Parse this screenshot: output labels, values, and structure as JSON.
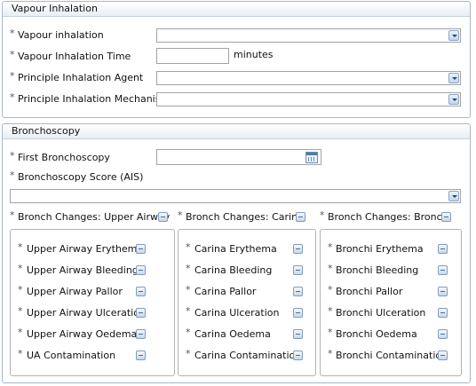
{
  "vapour": {
    "title": "Vapour Inhalation",
    "vapour_inhalation": "Vapour inhalation",
    "inhalation_time": "Vapour Inhalation Time",
    "minutes": "minutes",
    "agent": "Principle Inhalation Agent",
    "mechanism": "Principle Inhalation Mechanism"
  },
  "bronch": {
    "title": "Bronchoscopy",
    "first": "First Bronchoscopy",
    "score": "Bronchoscopy Score (AIS)",
    "col1": {
      "header": "Bronch Changes: Upper Airway",
      "items": [
        "Upper Airway Erythema",
        "Upper Airway Bleeding",
        "Upper Airway Pallor",
        "Upper Airway Ulceration",
        "Upper Airway Oedema",
        "UA Contamination"
      ]
    },
    "col2": {
      "header": "Bronch Changes: Carina",
      "items": [
        "Carina Erythema",
        "Carina Bleeding",
        "Carina Pallor",
        "Carina Ulceration",
        "Carina Oedema",
        "Carina Contamination"
      ]
    },
    "col3": {
      "header": "Bronch Changes: Bronchi",
      "items": [
        "Bronchi Erythema",
        "Bronchi Bleeding",
        "Bronchi Pallor",
        "Bronchi Ulceration",
        "Bronchi Oedema",
        "Bronchi Contamination"
      ]
    }
  },
  "required_marker": "*"
}
